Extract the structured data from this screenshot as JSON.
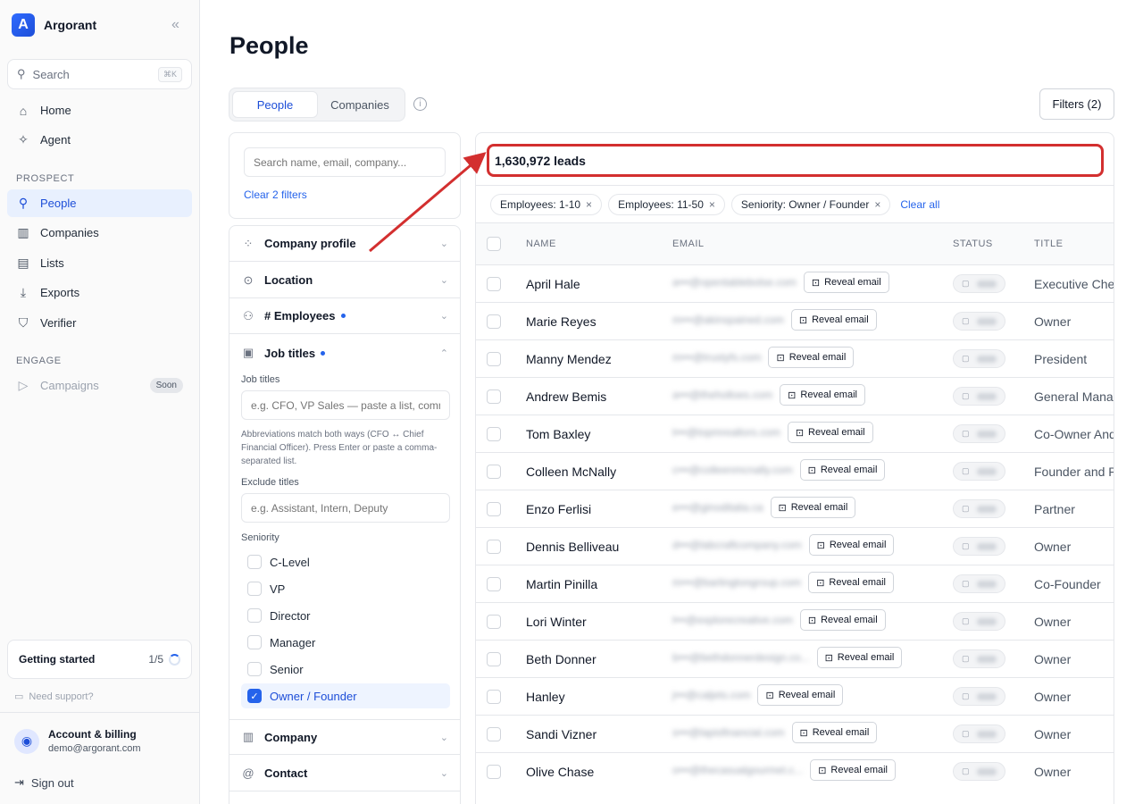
{
  "app": {
    "name": "Argorant"
  },
  "sidebar": {
    "search_label": "Search",
    "search_shortcut": "⌘K",
    "nav_top": [
      {
        "label": "Home",
        "icon": "home-icon"
      },
      {
        "label": "Agent",
        "icon": "sparkle-icon"
      }
    ],
    "prospect_label": "PROSPECT",
    "prospect_items": [
      {
        "label": "People",
        "icon": "search-icon",
        "active": true
      },
      {
        "label": "Companies",
        "icon": "building-icon"
      },
      {
        "label": "Lists",
        "icon": "list-icon"
      },
      {
        "label": "Exports",
        "icon": "download-icon"
      },
      {
        "label": "Verifier",
        "icon": "shield-check-icon"
      }
    ],
    "engage_label": "ENGAGE",
    "engage_items": [
      {
        "label": "Campaigns",
        "icon": "send-icon",
        "badge": "Soon",
        "disabled": true
      }
    ],
    "getting_started": {
      "label": "Getting started",
      "progress": "1/5"
    },
    "support_label": "Need support?",
    "account": {
      "title": "Account & billing",
      "email": "demo@argorant.com"
    },
    "signout_label": "Sign out"
  },
  "main": {
    "title": "People",
    "tabs": [
      {
        "label": "People",
        "active": true
      },
      {
        "label": "Companies",
        "active": false
      }
    ],
    "filters_button": "Filters (2)"
  },
  "filters": {
    "search_placeholder": "Search name, email, company...",
    "clear_label": "Clear 2 filters",
    "sections": {
      "company_profile": "Company profile",
      "location": "Location",
      "employees": "# Employees",
      "job_titles": "Job titles",
      "company": "Company",
      "contact": "Contact"
    },
    "job_titles_label": "Job titles",
    "job_titles_placeholder": "e.g. CFO, VP Sales — paste a list, comma-separated",
    "job_titles_help": "Abbreviations match both ways (CFO ↔ Chief Financial Officer). Press Enter or paste a comma-separated list.",
    "exclude_label": "Exclude titles",
    "exclude_placeholder": "e.g. Assistant, Intern, Deputy",
    "seniority_label": "Seniority",
    "seniority_options": [
      {
        "label": "C-Level",
        "checked": false
      },
      {
        "label": "VP",
        "checked": false
      },
      {
        "label": "Director",
        "checked": false
      },
      {
        "label": "Manager",
        "checked": false
      },
      {
        "label": "Senior",
        "checked": false
      },
      {
        "label": "Owner / Founder",
        "checked": true
      }
    ]
  },
  "results": {
    "count_label": "1,630,972 leads",
    "chips": [
      "Employees: 1-10",
      "Employees: 11-50",
      "Seniority: Owner / Founder"
    ],
    "clear_all": "Clear all",
    "columns": {
      "name": "NAME",
      "email": "EMAIL",
      "status": "STATUS",
      "title": "TITLE"
    },
    "reveal_label": "Reveal email",
    "rows": [
      {
        "name": "April Hale",
        "email": "a•••@opentablebolse.com",
        "title": "Executive Chef"
      },
      {
        "name": "Marie Reyes",
        "email": "m•••@akinspained.com",
        "title": "Owner"
      },
      {
        "name": "Manny Mendez",
        "email": "m•••@trustyfs.com",
        "title": "President"
      },
      {
        "name": "Andrew Bemis",
        "email": "a•••@theholloes.com",
        "title": "General Manager"
      },
      {
        "name": "Tom Baxley",
        "email": "t•••@topmrealtors.com",
        "title": "Co-Owner And"
      },
      {
        "name": "Colleen McNally",
        "email": "c•••@colleenmcnally.com",
        "title": "Founder and P"
      },
      {
        "name": "Enzo Ferlisi",
        "email": "e•••@ginoditalia.ca",
        "title": "Partner"
      },
      {
        "name": "Dennis Belliveau",
        "email": "d•••@labcraftcompany.com",
        "title": "Owner"
      },
      {
        "name": "Martin Pinilla",
        "email": "m•••@barlingtongroup.com",
        "title": "Co-Founder"
      },
      {
        "name": "Lori Winter",
        "email": "l•••@explorecreative.com",
        "title": "Owner"
      },
      {
        "name": "Beth Donner",
        "email": "b•••@bethdonnerdesign.co...",
        "title": "Owner"
      },
      {
        "name": "Hanley",
        "email": "j•••@caljets.com",
        "title": "Owner"
      },
      {
        "name": "Sandi Vizner",
        "email": "s•••@lapisfinancial.com",
        "title": "Owner"
      },
      {
        "name": "Olive Chase",
        "email": "o•••@thecasualgourmet.c...",
        "title": "Owner"
      }
    ]
  }
}
